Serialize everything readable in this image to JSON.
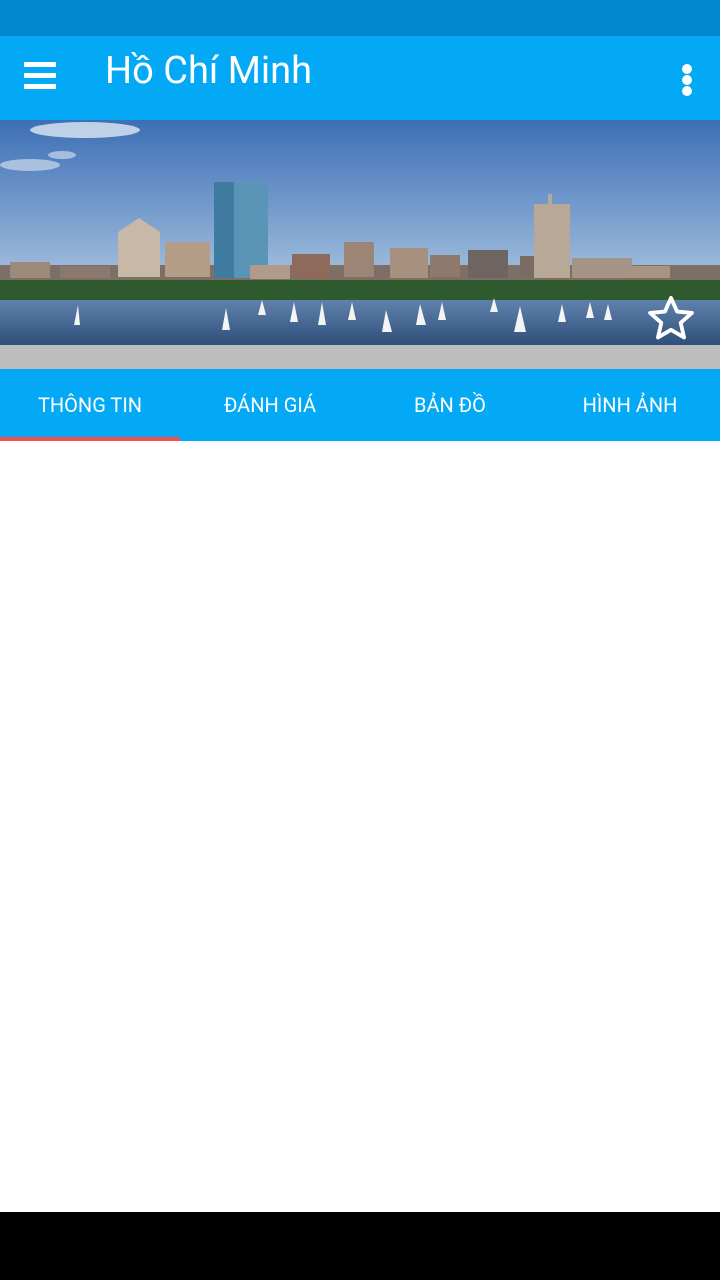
{
  "app_bar": {
    "title": "Hồ Chí Minh",
    "menu_icon": "hamburger-menu-icon",
    "more_icon": "more-vert-icon",
    "background": "#03A9F4"
  },
  "status_bar": {
    "background": "#0288D1"
  },
  "banner": {
    "favorite_icon": "star-outline-icon"
  },
  "tabs": [
    {
      "label": "THÔNG TIN",
      "selected": true
    },
    {
      "label": "ĐÁNH GIÁ",
      "selected": false
    },
    {
      "label": "BẢN ĐỒ",
      "selected": false
    },
    {
      "label": "HÌNH ẢNH",
      "selected": false
    }
  ],
  "colors": {
    "accent_indicator": "#EF5350",
    "tab_background": "#03A9F4",
    "strip": "#BDBDBD"
  }
}
